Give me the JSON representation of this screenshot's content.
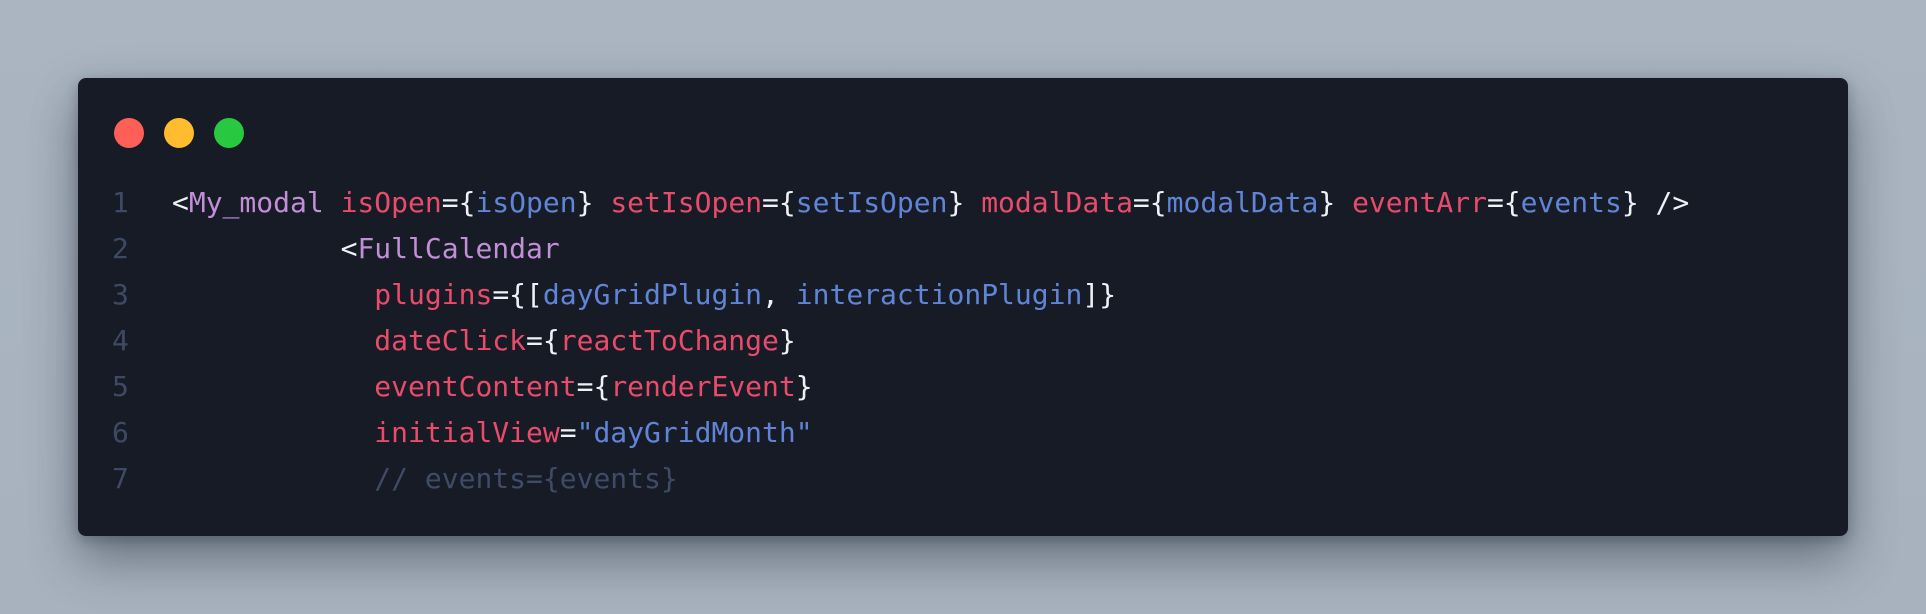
{
  "window": {
    "traffic_lights": [
      {
        "name": "close",
        "color": "#fe5f57"
      },
      {
        "name": "minimize",
        "color": "#febc2e"
      },
      {
        "name": "zoom",
        "color": "#28c840"
      }
    ]
  },
  "colors": {
    "background": "#a9b4c0",
    "editor": "#171b26",
    "line_number": "#3e4963",
    "tag": "#c08fd6",
    "punctuation": "#eef1f6",
    "attribute": "#e94b6b",
    "expression": "#6085d6",
    "comment": "#3f4b67"
  },
  "code": {
    "language": "jsx",
    "lines": [
      {
        "number": "1",
        "tokens": [
          {
            "type": "punct",
            "text": "<"
          },
          {
            "type": "tag",
            "text": "My_modal"
          },
          {
            "type": "punct",
            "text": " "
          },
          {
            "type": "attr",
            "text": "isOpen"
          },
          {
            "type": "punct",
            "text": "={"
          },
          {
            "type": "expr",
            "text": "isOpen"
          },
          {
            "type": "punct",
            "text": "} "
          },
          {
            "type": "attr",
            "text": "setIsOpen"
          },
          {
            "type": "punct",
            "text": "={"
          },
          {
            "type": "expr",
            "text": "setIsOpen"
          },
          {
            "type": "punct",
            "text": "} "
          },
          {
            "type": "attr",
            "text": "modalData"
          },
          {
            "type": "punct",
            "text": "={"
          },
          {
            "type": "expr",
            "text": "modalData"
          },
          {
            "type": "punct",
            "text": "} "
          },
          {
            "type": "attr",
            "text": "eventArr"
          },
          {
            "type": "punct",
            "text": "={"
          },
          {
            "type": "expr",
            "text": "events"
          },
          {
            "type": "punct",
            "text": "} />"
          }
        ]
      },
      {
        "number": "2",
        "tokens": [
          {
            "type": "punct",
            "text": "          <"
          },
          {
            "type": "tag",
            "text": "FullCalendar"
          }
        ]
      },
      {
        "number": "3",
        "tokens": [
          {
            "type": "punct",
            "text": "            "
          },
          {
            "type": "attr",
            "text": "plugins"
          },
          {
            "type": "punct",
            "text": "={["
          },
          {
            "type": "expr",
            "text": "dayGridPlugin"
          },
          {
            "type": "punct",
            "text": ", "
          },
          {
            "type": "expr",
            "text": "interactionPlugin"
          },
          {
            "type": "punct",
            "text": "]}"
          }
        ]
      },
      {
        "number": "4",
        "tokens": [
          {
            "type": "punct",
            "text": "            "
          },
          {
            "type": "attr",
            "text": "dateClick"
          },
          {
            "type": "punct",
            "text": "={"
          },
          {
            "type": "attr",
            "text": "reactToChange"
          },
          {
            "type": "punct",
            "text": "}"
          }
        ]
      },
      {
        "number": "5",
        "tokens": [
          {
            "type": "punct",
            "text": "            "
          },
          {
            "type": "attr",
            "text": "eventContent"
          },
          {
            "type": "punct",
            "text": "={"
          },
          {
            "type": "attr",
            "text": "renderEvent"
          },
          {
            "type": "punct",
            "text": "}"
          }
        ]
      },
      {
        "number": "6",
        "tokens": [
          {
            "type": "punct",
            "text": "            "
          },
          {
            "type": "attr",
            "text": "initialView"
          },
          {
            "type": "punct",
            "text": "="
          },
          {
            "type": "str",
            "text": "\"dayGridMonth\""
          }
        ]
      },
      {
        "number": "7",
        "tokens": [
          {
            "type": "punct",
            "text": "            "
          },
          {
            "type": "comment",
            "text": "// events={events}"
          }
        ]
      }
    ]
  }
}
